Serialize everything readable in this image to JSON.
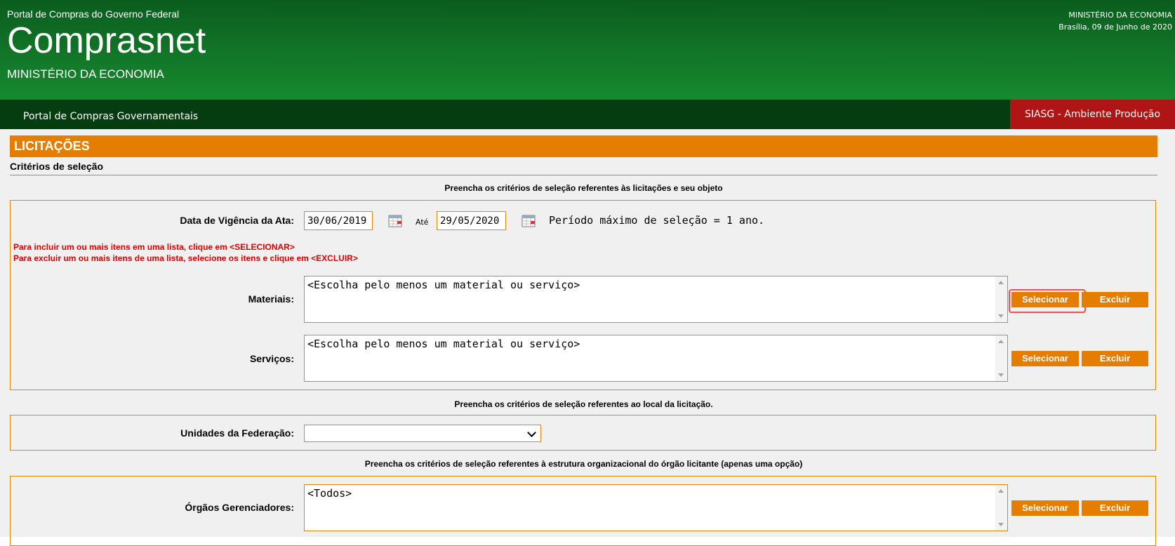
{
  "header": {
    "portal_name": "Portal de Compras do Governo Federal",
    "title": "Comprasnet",
    "ministry": "MINISTÉRIO DA ECONOMIA",
    "right_ministry": "MINISTÉRIO DA ECONOMIA",
    "right_date": "Brasília, 09 de Junho de 2020"
  },
  "nav": {
    "link": "Portal de Compras Governamentais",
    "environment": "SIASG - Ambiente Produção"
  },
  "section": {
    "title": "LICITAÇÕES",
    "subtitle": "Critérios de seleção",
    "instruction_object": "Preencha os critérios de seleção referentes às licitações e seu objeto",
    "instruction_local": "Preencha os critérios de seleção referentes ao local da licitação.",
    "instruction_org": "Preencha os critérios de seleção referentes à estrutura organizacional do órgão licitante (apenas uma opção)"
  },
  "vigencia": {
    "label": "Data de Vigência da Ata:",
    "start": "30/06/2019",
    "until_label": "Até",
    "end": "29/05/2020",
    "note": "Período máximo de seleção = 1 ano."
  },
  "help": {
    "include": "Para incluir um ou mais itens em uma lista, clique em <SELECIONAR>",
    "exclude": "Para excluir um ou mais itens de uma lista, selecione os itens e clique em <EXCLUIR>"
  },
  "materiais": {
    "label": "Materiais:",
    "value": "<Escolha pelo menos um material ou serviço>",
    "select_btn": "Selecionar",
    "exclude_btn": "Excluir"
  },
  "servicos": {
    "label": "Serviços:",
    "value": "<Escolha pelo menos um material ou serviço>",
    "select_btn": "Selecionar",
    "exclude_btn": "Excluir"
  },
  "uf": {
    "label": "Unidades da Federação:",
    "value": ""
  },
  "orgaos": {
    "label": "Órgãos Gerenciadores:",
    "value": "<Todos>",
    "select_btn": "Selecionar",
    "exclude_btn": "Excluir"
  },
  "colors": {
    "header_green": "#178a2f",
    "nav_green": "#063d10",
    "accent_orange": "#e57d00",
    "env_red": "#b01515",
    "help_red": "#e00000",
    "highlight": "#ff4a4a"
  }
}
